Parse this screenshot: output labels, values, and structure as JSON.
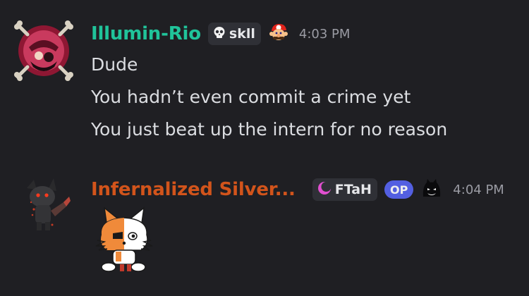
{
  "messages": [
    {
      "username": "Illumin-Rio",
      "username_color": "#20c39a",
      "tag": {
        "icon": "skull-icon",
        "text": "skll"
      },
      "role_icon": "mario-head-icon",
      "timestamp": "4:03 PM",
      "lines": [
        "Dude",
        "You hadn’t even commit a crime yet",
        "You just beat up the intern for no reason"
      ]
    },
    {
      "username": "Infernalized Silver...",
      "username_color": "#d2541b",
      "tag": {
        "icon": "crescent-moon-icon",
        "text": "FTaH"
      },
      "badge": "OP",
      "role_icon": "shadow-creature-icon",
      "timestamp": "4:04 PM",
      "sticker": "fox-sticker"
    }
  ]
}
